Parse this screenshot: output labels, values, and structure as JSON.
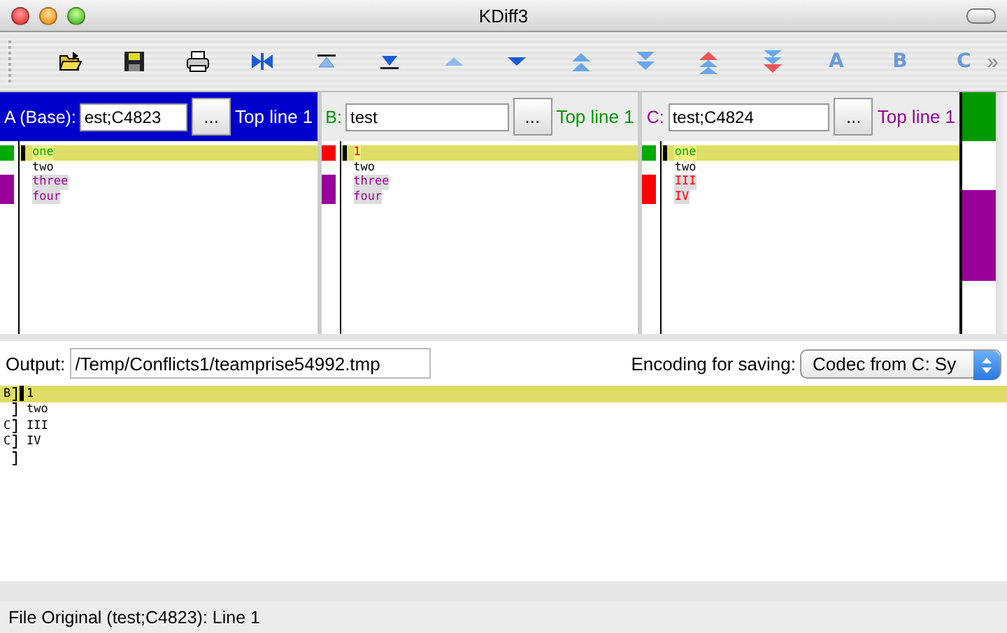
{
  "window": {
    "title": "KDiff3"
  },
  "toolbar": {
    "buttons": [
      {
        "kind": "open"
      },
      {
        "kind": "save"
      },
      {
        "kind": "print"
      },
      {
        "kind": "join"
      },
      {
        "kind": "first"
      },
      {
        "kind": "last"
      },
      {
        "kind": "prev"
      },
      {
        "kind": "next"
      },
      {
        "kind": "prev-conflict"
      },
      {
        "kind": "next-conflict"
      },
      {
        "kind": "prev-unsolved"
      },
      {
        "kind": "next-unsolved"
      },
      {
        "kind": "letter",
        "label": "A"
      },
      {
        "kind": "letter",
        "label": "B"
      },
      {
        "kind": "letter",
        "label": "C"
      }
    ],
    "overflow": "»"
  },
  "panes": [
    {
      "label": "A (Base):",
      "path": "est;C4823",
      "browse": "...",
      "top_line": "Top line 1",
      "active": true,
      "lines": [
        {
          "text": "one",
          "color": "#00aa00",
          "selected": true
        },
        {
          "text": "two",
          "selected": false
        },
        {
          "text": "three",
          "color": "#990099",
          "selected": false
        },
        {
          "text": "four",
          "color": "#990099",
          "selected": false
        }
      ]
    },
    {
      "label": "B:",
      "path": "test",
      "browse": "...",
      "top_line": "Top line 1",
      "active": false,
      "color": "#009900",
      "lines": [
        {
          "text": "1",
          "color": "#ff0000",
          "selected": true
        },
        {
          "text": "two",
          "selected": false
        },
        {
          "text": "three",
          "color": "#990099",
          "selected": false
        },
        {
          "text": "four",
          "color": "#990099",
          "selected": false
        }
      ]
    },
    {
      "label": "C:",
      "path": "test;C4824",
      "browse": "...",
      "top_line": "Top line 1",
      "active": false,
      "color": "#990099",
      "lines": [
        {
          "text": "one",
          "color": "#00aa00",
          "selected": true
        },
        {
          "text": "two",
          "selected": false
        },
        {
          "text": "III",
          "color": "#ff0000",
          "selected": false
        },
        {
          "text": "IV",
          "color": "#ff0000",
          "selected": false
        }
      ]
    }
  ],
  "overview": [
    {
      "color": "#009900"
    },
    {
      "color": "#ffffff"
    },
    {
      "color": "#990099"
    }
  ],
  "output": {
    "label": "Output:",
    "path": "/Temp/Conflicts1/teamprise54992.tmp",
    "encoding_label": "Encoding for saving:",
    "encoding": "Codec from C: Sy",
    "lines": [
      {
        "source": "B",
        "text": "1",
        "selected": true
      },
      {
        "text": "two",
        "selected": false
      },
      {
        "source": "C",
        "text": "III",
        "selected": false
      },
      {
        "source": "C",
        "text": "IV",
        "selected": false
      },
      {
        "selected": false
      }
    ]
  },
  "status_bar": "File Original (test;C4823): Line 1"
}
